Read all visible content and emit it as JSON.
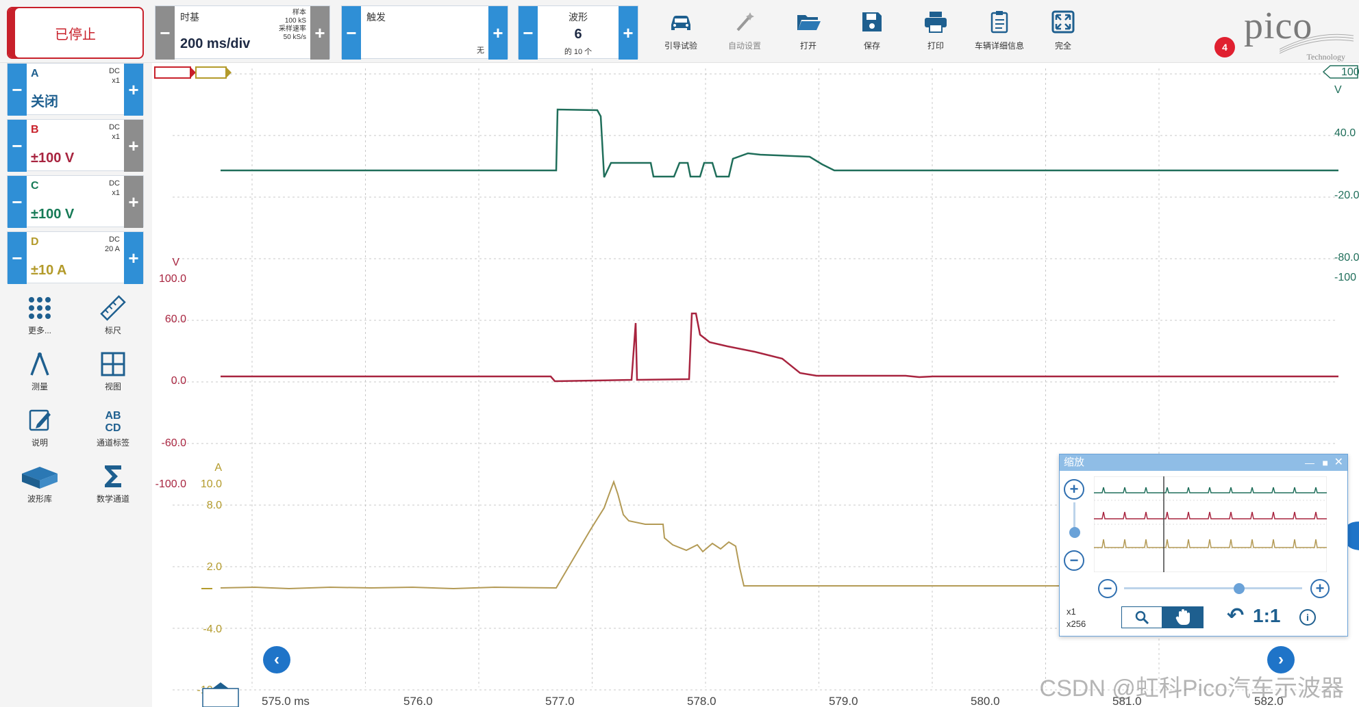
{
  "toolbar": {
    "stop_label": "已停止",
    "timebase": {
      "label": "时基",
      "value": "200 ms/div",
      "samples_label": "样本",
      "samples_value": "100 kS",
      "rate_label": "采样速率",
      "rate_value": "50 kS/s"
    },
    "trigger": {
      "label": "触发",
      "mode": "无"
    },
    "waveform": {
      "label": "波形",
      "count": "6",
      "of_label": "的 10 个"
    },
    "tools": [
      {
        "label": "引导试验",
        "icon": "car-icon"
      },
      {
        "label": "自动设置",
        "icon": "magic-wand-icon"
      },
      {
        "label": "打开",
        "icon": "folder-icon"
      },
      {
        "label": "保存",
        "icon": "save-icon"
      },
      {
        "label": "打印",
        "icon": "printer-icon"
      },
      {
        "label": "车辆详细信息",
        "icon": "clipboard-icon"
      },
      {
        "label": "完全",
        "icon": "fullscreen-icon"
      }
    ],
    "notification_count": "4",
    "logo_text": "pico",
    "logo_sub": "Technology"
  },
  "channels": [
    {
      "name": "A",
      "coupling": "DC",
      "probe": "x1",
      "range": "关闭",
      "color": "#1f6e5a"
    },
    {
      "name": "B",
      "coupling": "DC",
      "probe": "x1",
      "range": "±100 V",
      "color": "#a8243f"
    },
    {
      "name": "C",
      "coupling": "DC",
      "probe": "x1",
      "range": "±100 V",
      "color": "#167a56"
    },
    {
      "name": "D",
      "coupling": "DC",
      "probe": "20 A",
      "range": "±10 A",
      "color": "#a8882a"
    }
  ],
  "side_tools": [
    {
      "label": "更多...",
      "icon": "grid-dots-icon"
    },
    {
      "label": "标尺",
      "icon": "ruler-icon"
    },
    {
      "label": "测量",
      "icon": "caliper-icon"
    },
    {
      "label": "视图",
      "icon": "view-grid-icon"
    },
    {
      "label": "说明",
      "icon": "notes-icon"
    },
    {
      "label": "通道标签",
      "icon": "channel-labels-icon"
    },
    {
      "label": "波形库",
      "icon": "waveform-library-icon"
    },
    {
      "label": "数学通道",
      "icon": "sigma-icon"
    }
  ],
  "graph": {
    "x_unit": "ms",
    "x_ticks": [
      "575.0 ms",
      "576.0",
      "577.0",
      "578.0",
      "579.0",
      "580.0",
      "581.0",
      "582.0"
    ],
    "c_axis": {
      "unit": "V",
      "ticks": [
        "100.0",
        "60.0",
        "0.0",
        "-60.0",
        "-100.0"
      ]
    },
    "d_axis": {
      "unit": "A",
      "ticks": [
        "10.0",
        "8.0",
        "2.0",
        "-4.0",
        "-10.0"
      ]
    },
    "right_axis": {
      "unit": "V",
      "top_label": "100",
      "ticks": [
        "40.0",
        "-20.0",
        "-80.0",
        "-100"
      ]
    },
    "colors": {
      "channelA": "#1f6e5a",
      "channelB": "#a8243f",
      "channelD": "#b39a55",
      "grid": "#c8c8c8"
    }
  },
  "zoom_panel": {
    "title": "缩放",
    "zoom_x": "x1",
    "zoom_y": "x256",
    "ratio": "1:1"
  },
  "watermark": "CSDN @虹科Pico汽车示波器"
}
